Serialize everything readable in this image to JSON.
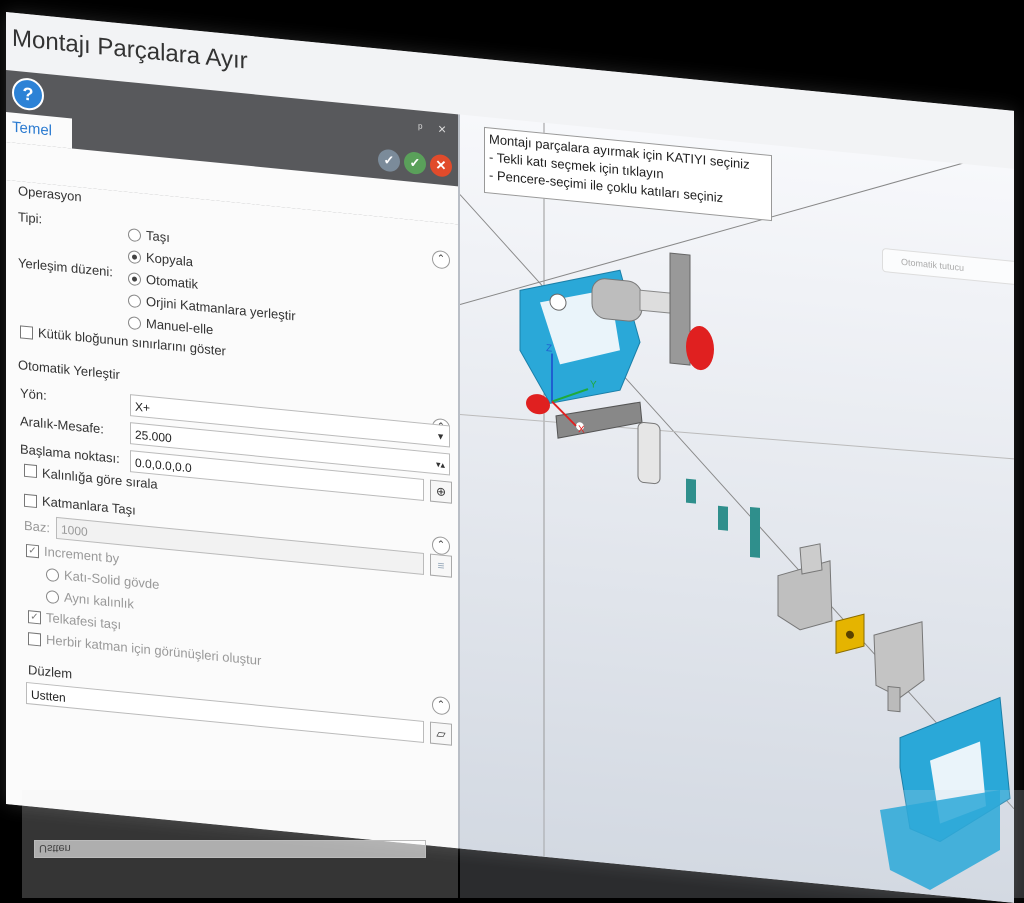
{
  "title": "Montajı Parçalara Ayır",
  "ribbon": {
    "help": "?",
    "pin": "ᵖ",
    "close": "×",
    "tab": "Temel"
  },
  "operation": {
    "heading": "Operasyon",
    "type_label": "Tipi:",
    "type_options": [
      "Taşı",
      "Kopyala"
    ],
    "type_selected": "Kopyala",
    "layout_label": "Yerleşim düzeni:",
    "layout_options": [
      "Otomatik",
      "Orjini Katmanlara yerleştir",
      "Manuel-elle"
    ],
    "layout_selected": "Otomatik",
    "bounds_checkbox": "Kütük bloğunun sınırlarını göster"
  },
  "auto": {
    "heading": "Otomatik Yerleştir",
    "dir_label": "Yön:",
    "dir_value": "X+",
    "gap_label": "Aralık-Mesafe:",
    "gap_value": "25.000",
    "start_label": "Başlama noktası:",
    "start_value": "0.0,0.0,0.0",
    "sort_checkbox": "Kalınlığa göre sırala"
  },
  "layers": {
    "checkbox": "Katmanlara Taşı",
    "base_label": "Baz:",
    "base_value": "1000",
    "increment": "Increment by",
    "inc_options": [
      "Katı-Solid gövde",
      "Aynı kalınlık"
    ],
    "wire": "Telkafesi taşı",
    "views": "Herbir katman için görünüşleri oluştur"
  },
  "plane": {
    "heading": "Düzlem",
    "value": "Ustten"
  },
  "tooltip": {
    "line1": "Montajı parçalara ayırmak için KATIYI seçiniz",
    "line2": "- Tekli katı seçmek için tıklayın",
    "line3": "- Pencere-seçimi ile çoklu katıları seçiniz"
  },
  "viewport_search": "Otomatik tutucu",
  "axes": {
    "x": "X",
    "y": "Y",
    "z": "Z"
  },
  "colors": {
    "cyan": "#2aa8d8",
    "teal": "#2f8f8c",
    "gold": "#e5b400",
    "red": "#e02020",
    "ribbon": "#58595c"
  }
}
